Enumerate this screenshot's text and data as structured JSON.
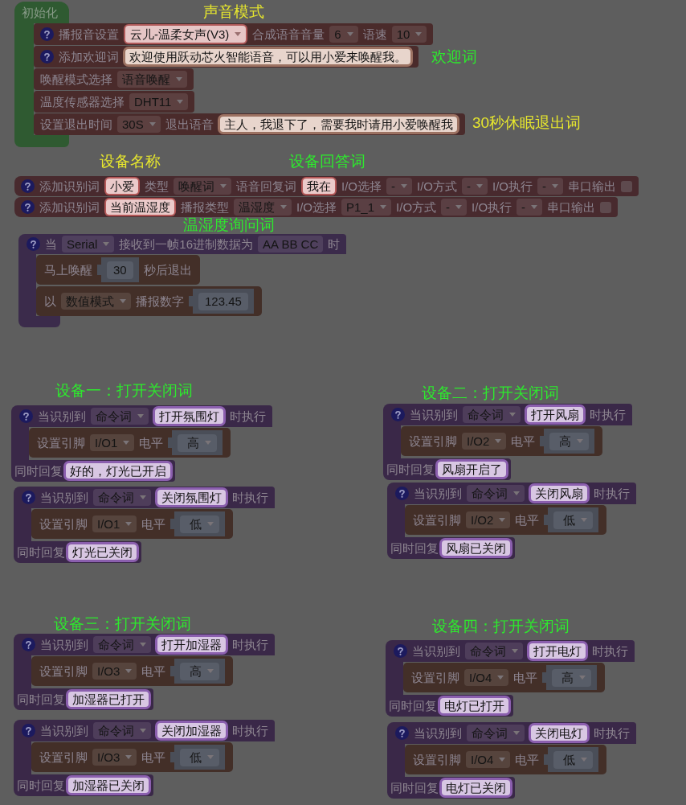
{
  "annotations": [
    {
      "text": "声音模式",
      "color": "#e6e62e"
    },
    {
      "text": "欢迎词",
      "color": "#2ee82e"
    },
    {
      "text": "30秒休眠退出词",
      "color": "#e6e62e"
    },
    {
      "text": "设备名称",
      "color": "#e6e62e"
    },
    {
      "text": "设备回答词",
      "color": "#2ee82e"
    },
    {
      "text": "温湿度询问词",
      "color": "#2ee82e"
    },
    {
      "text": "设备一：打开关闭词",
      "color": "#2ee82e"
    },
    {
      "text": "设备二：打开关闭词",
      "color": "#2ee82e"
    },
    {
      "text": "设备三：打开关闭词",
      "color": "#2ee82e"
    },
    {
      "text": "设备四：打开关闭词",
      "color": "#2ee82e"
    }
  ],
  "init_block": {
    "title": "初始化",
    "rows": [
      {
        "parts": [
          {
            "kind": "help"
          },
          {
            "kind": "label",
            "text": "播报音设置"
          },
          {
            "kind": "light_dropdown",
            "text": "云儿-温柔女声(V3)"
          },
          {
            "kind": "label",
            "text": "合成语音音量"
          },
          {
            "kind": "dropdown",
            "text": "6"
          },
          {
            "kind": "label",
            "text": "语速"
          },
          {
            "kind": "dropdown",
            "text": "10"
          }
        ]
      },
      {
        "parts": [
          {
            "kind": "help"
          },
          {
            "kind": "label",
            "text": "添加欢迎词"
          },
          {
            "kind": "field",
            "text": "欢迎使用跃动芯火智能语音，可以用小爱来唤醒我。"
          }
        ]
      },
      {
        "parts": [
          {
            "kind": "label",
            "text": "唤醒模式选择"
          },
          {
            "kind": "dropdown",
            "text": "语音唤醒"
          }
        ]
      },
      {
        "parts": [
          {
            "kind": "label",
            "text": "温度传感器选择"
          },
          {
            "kind": "dropdown",
            "text": "DHT11"
          }
        ]
      },
      {
        "parts": [
          {
            "kind": "label",
            "text": "设置退出时间"
          },
          {
            "kind": "dropdown",
            "text": "30S"
          },
          {
            "kind": "label",
            "text": "退出语音"
          },
          {
            "kind": "field",
            "text": "主人，我退下了，需要我时请用小爱唤醒我"
          }
        ]
      }
    ]
  },
  "keyword_blocks": [
    {
      "parts": [
        {
          "kind": "help"
        },
        {
          "kind": "label",
          "text": "添加识别词"
        },
        {
          "kind": "field",
          "text": "小爱"
        },
        {
          "kind": "label",
          "text": "类型"
        },
        {
          "kind": "dropdown",
          "text": "唤醒词"
        },
        {
          "kind": "label",
          "text": "语音回复词"
        },
        {
          "kind": "field",
          "text": "我在"
        },
        {
          "kind": "label",
          "text": "I/O选择"
        },
        {
          "kind": "dropdown",
          "text": "-"
        },
        {
          "kind": "label",
          "text": "I/O方式"
        },
        {
          "kind": "dropdown",
          "text": "-"
        },
        {
          "kind": "label",
          "text": "I/O执行"
        },
        {
          "kind": "dropdown",
          "text": "-"
        },
        {
          "kind": "label",
          "text": "串口输出"
        },
        {
          "kind": "checkbox",
          "checked": false
        }
      ]
    },
    {
      "parts": [
        {
          "kind": "help"
        },
        {
          "kind": "label",
          "text": "添加识别词"
        },
        {
          "kind": "field",
          "text": "当前温湿度"
        },
        {
          "kind": "label",
          "text": "播报类型"
        },
        {
          "kind": "dropdown",
          "text": "温湿度"
        },
        {
          "kind": "label",
          "text": "I/O选择"
        },
        {
          "kind": "dropdown",
          "text": "P1_1"
        },
        {
          "kind": "label",
          "text": "I/O方式"
        },
        {
          "kind": "dropdown",
          "text": "-"
        },
        {
          "kind": "label",
          "text": "I/O执行"
        },
        {
          "kind": "dropdown",
          "text": "-"
        },
        {
          "kind": "label",
          "text": "串口输出"
        },
        {
          "kind": "checkbox",
          "checked": false
        }
      ]
    }
  ],
  "serial_block": {
    "header": [
      {
        "kind": "help"
      },
      {
        "kind": "label",
        "text": "当"
      },
      {
        "kind": "dropdown",
        "text": "Serial"
      },
      {
        "kind": "label",
        "text": "接收到一帧16进制数据为"
      },
      {
        "kind": "plain_field",
        "text": "AA BB CC"
      },
      {
        "kind": "label",
        "text": "时"
      }
    ],
    "body": [
      {
        "parts": [
          {
            "kind": "label",
            "text": "马上唤醒"
          },
          {
            "kind": "value",
            "text": "30"
          },
          {
            "kind": "label",
            "text": "秒后退出"
          }
        ]
      },
      {
        "parts": [
          {
            "kind": "label",
            "text": "以"
          },
          {
            "kind": "dropdown",
            "text": "数值模式"
          },
          {
            "kind": "label",
            "text": "播报数字"
          },
          {
            "kind": "value",
            "text": "123.45"
          }
        ]
      }
    ]
  },
  "command_blocks": [
    {
      "header": [
        {
          "kind": "help"
        },
        {
          "kind": "label",
          "text": "当识别到"
        },
        {
          "kind": "dropdown",
          "text": "命令词"
        },
        {
          "kind": "field",
          "text": "打开氛围灯"
        },
        {
          "kind": "label",
          "text": "时执行"
        }
      ],
      "body": [
        {
          "kind": "label",
          "text": "设置引脚"
        },
        {
          "kind": "dropdown",
          "text": "I/O1"
        },
        {
          "kind": "label",
          "text": "电平"
        },
        {
          "kind": "value_dropdown",
          "text": "高"
        }
      ],
      "footer": [
        {
          "kind": "label",
          "text": "同时回复"
        },
        {
          "kind": "field",
          "text": "好的，灯光已开启"
        }
      ]
    },
    {
      "header": [
        {
          "kind": "help"
        },
        {
          "kind": "label",
          "text": "当识别到"
        },
        {
          "kind": "dropdown",
          "text": "命令词"
        },
        {
          "kind": "field",
          "text": "关闭氛围灯"
        },
        {
          "kind": "label",
          "text": "时执行"
        }
      ],
      "body": [
        {
          "kind": "label",
          "text": "设置引脚"
        },
        {
          "kind": "dropdown",
          "text": "I/O1"
        },
        {
          "kind": "label",
          "text": "电平"
        },
        {
          "kind": "value_dropdown",
          "text": "低"
        }
      ],
      "footer": [
        {
          "kind": "label",
          "text": "同时回复"
        },
        {
          "kind": "field",
          "text": "灯光已关闭"
        }
      ]
    },
    {
      "header": [
        {
          "kind": "help"
        },
        {
          "kind": "label",
          "text": "当识别到"
        },
        {
          "kind": "dropdown",
          "text": "命令词"
        },
        {
          "kind": "field",
          "text": "打开风扇"
        },
        {
          "kind": "label",
          "text": "时执行"
        }
      ],
      "body": [
        {
          "kind": "label",
          "text": "设置引脚"
        },
        {
          "kind": "dropdown",
          "text": "I/O2"
        },
        {
          "kind": "label",
          "text": "电平"
        },
        {
          "kind": "value_dropdown",
          "text": "高"
        }
      ],
      "footer": [
        {
          "kind": "label",
          "text": "同时回复"
        },
        {
          "kind": "field",
          "text": "风扇开启了"
        }
      ]
    },
    {
      "header": [
        {
          "kind": "help"
        },
        {
          "kind": "label",
          "text": "当识别到"
        },
        {
          "kind": "dropdown",
          "text": "命令词"
        },
        {
          "kind": "field",
          "text": "关闭风扇"
        },
        {
          "kind": "label",
          "text": "时执行"
        }
      ],
      "body": [
        {
          "kind": "label",
          "text": "设置引脚"
        },
        {
          "kind": "dropdown",
          "text": "I/O2"
        },
        {
          "kind": "label",
          "text": "电平"
        },
        {
          "kind": "value_dropdown",
          "text": "低"
        }
      ],
      "footer": [
        {
          "kind": "label",
          "text": "同时回复"
        },
        {
          "kind": "field",
          "text": "风扇已关闭"
        }
      ]
    },
    {
      "header": [
        {
          "kind": "help"
        },
        {
          "kind": "label",
          "text": "当识别到"
        },
        {
          "kind": "dropdown",
          "text": "命令词"
        },
        {
          "kind": "field",
          "text": "打开加湿器"
        },
        {
          "kind": "label",
          "text": "时执行"
        }
      ],
      "body": [
        {
          "kind": "label",
          "text": "设置引脚"
        },
        {
          "kind": "dropdown",
          "text": "I/O3"
        },
        {
          "kind": "label",
          "text": "电平"
        },
        {
          "kind": "value_dropdown",
          "text": "高"
        }
      ],
      "footer": [
        {
          "kind": "label",
          "text": "同时回复"
        },
        {
          "kind": "field",
          "text": "加湿器已打开"
        }
      ]
    },
    {
      "header": [
        {
          "kind": "help"
        },
        {
          "kind": "label",
          "text": "当识别到"
        },
        {
          "kind": "dropdown",
          "text": "命令词"
        },
        {
          "kind": "field",
          "text": "关闭加湿器"
        },
        {
          "kind": "label",
          "text": "时执行"
        }
      ],
      "body": [
        {
          "kind": "label",
          "text": "设置引脚"
        },
        {
          "kind": "dropdown",
          "text": "I/O3"
        },
        {
          "kind": "label",
          "text": "电平"
        },
        {
          "kind": "value_dropdown",
          "text": "低"
        }
      ],
      "footer": [
        {
          "kind": "label",
          "text": "同时回复"
        },
        {
          "kind": "field",
          "text": "加湿器已关闭"
        }
      ]
    },
    {
      "header": [
        {
          "kind": "help"
        },
        {
          "kind": "label",
          "text": "当识别到"
        },
        {
          "kind": "dropdown",
          "text": "命令词"
        },
        {
          "kind": "field",
          "text": "打开电灯"
        },
        {
          "kind": "label",
          "text": "时执行"
        }
      ],
      "body": [
        {
          "kind": "label",
          "text": "设置引脚"
        },
        {
          "kind": "dropdown",
          "text": "I/O4"
        },
        {
          "kind": "label",
          "text": "电平"
        },
        {
          "kind": "value_dropdown",
          "text": "高"
        }
      ],
      "footer": [
        {
          "kind": "label",
          "text": "同时回复"
        },
        {
          "kind": "field",
          "text": "电灯已打开"
        }
      ]
    },
    {
      "header": [
        {
          "kind": "help"
        },
        {
          "kind": "label",
          "text": "当识别到"
        },
        {
          "kind": "dropdown",
          "text": "命令词"
        },
        {
          "kind": "field",
          "text": "关闭电灯"
        },
        {
          "kind": "label",
          "text": "时执行"
        }
      ],
      "body": [
        {
          "kind": "label",
          "text": "设置引脚"
        },
        {
          "kind": "dropdown",
          "text": "I/O4"
        },
        {
          "kind": "label",
          "text": "电平"
        },
        {
          "kind": "value_dropdown",
          "text": "低"
        }
      ],
      "footer": [
        {
          "kind": "label",
          "text": "同时回复"
        },
        {
          "kind": "field",
          "text": "电灯已关闭"
        }
      ]
    }
  ]
}
